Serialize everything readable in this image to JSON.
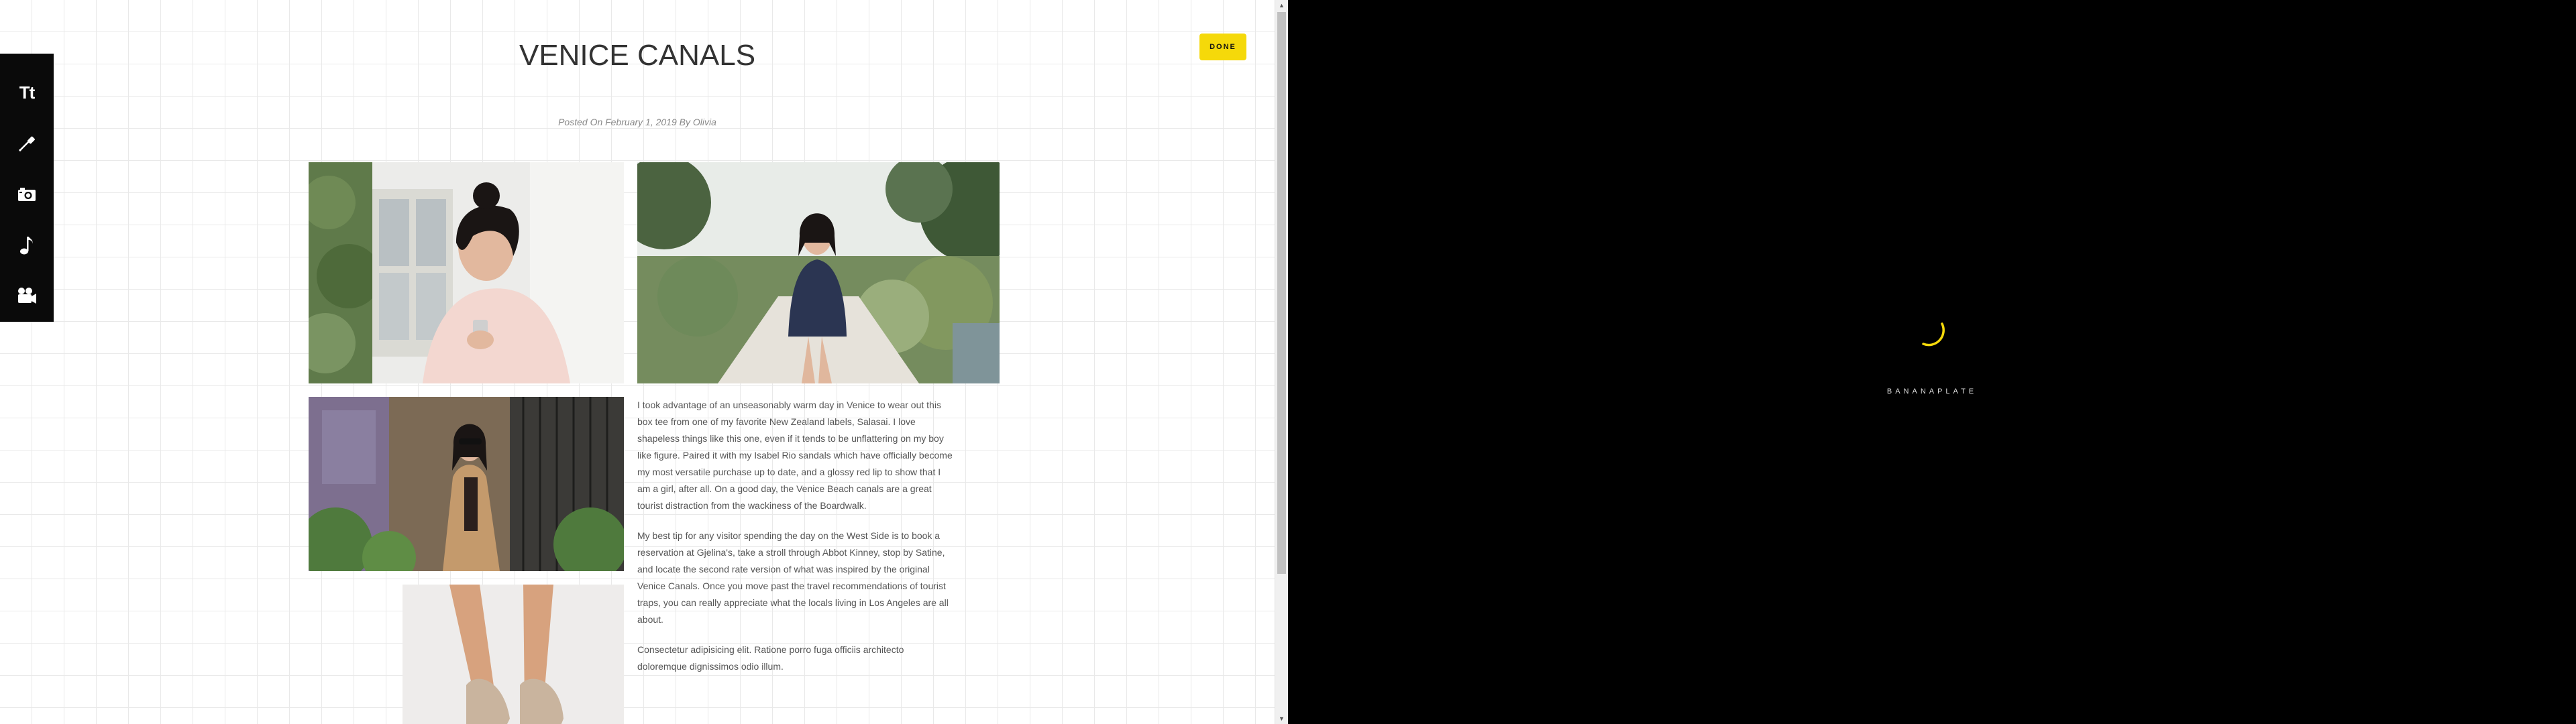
{
  "toolbar": {
    "text_tool_label": "Tt",
    "tools": [
      "text-tool",
      "eyedropper-tool",
      "camera-tool",
      "music-note-tool",
      "video-camera-tool"
    ]
  },
  "actions": {
    "done_label": "DONE"
  },
  "post": {
    "title": "VENICE CANALS",
    "meta": "Posted On February 1, 2019 By Olivia",
    "paragraphs": [
      "I took advantage of an unseasonably warm day in Venice to wear out this box tee from one of my favorite New Zealand labels, Salasai. I love shapeless things like this one, even if it tends to be unflattering on my boy like figure. Paired it with my Isabel Rio sandals which have officially become my most versatile purchase up to date, and a glossy red lip to show that I am a girl, after all. On a good day, the Venice Beach canals are a great tourist distraction from the wackiness of the Boardwalk.",
      "My best tip for any visitor spending the day on the West Side is to book a reservation at Gjelina's, take a stroll through Abbot Kinney, stop by Satine, and locate the second rate version of what was inspired by the original Venice Canals. Once you move past the travel recommendations of tourist traps, you can really appreciate what the locals living in Los Angeles are all about.",
      "Consectetur adipisicing elit. Ratione porro fuga officiis architecto doloremque dignissimos odio illum."
    ]
  },
  "loader": {
    "brand": "BANANAPLATE"
  },
  "colors": {
    "accent": "#f5d90a",
    "toolbar_bg": "#0a0a0a",
    "grid_line": "#e9e9e9"
  }
}
